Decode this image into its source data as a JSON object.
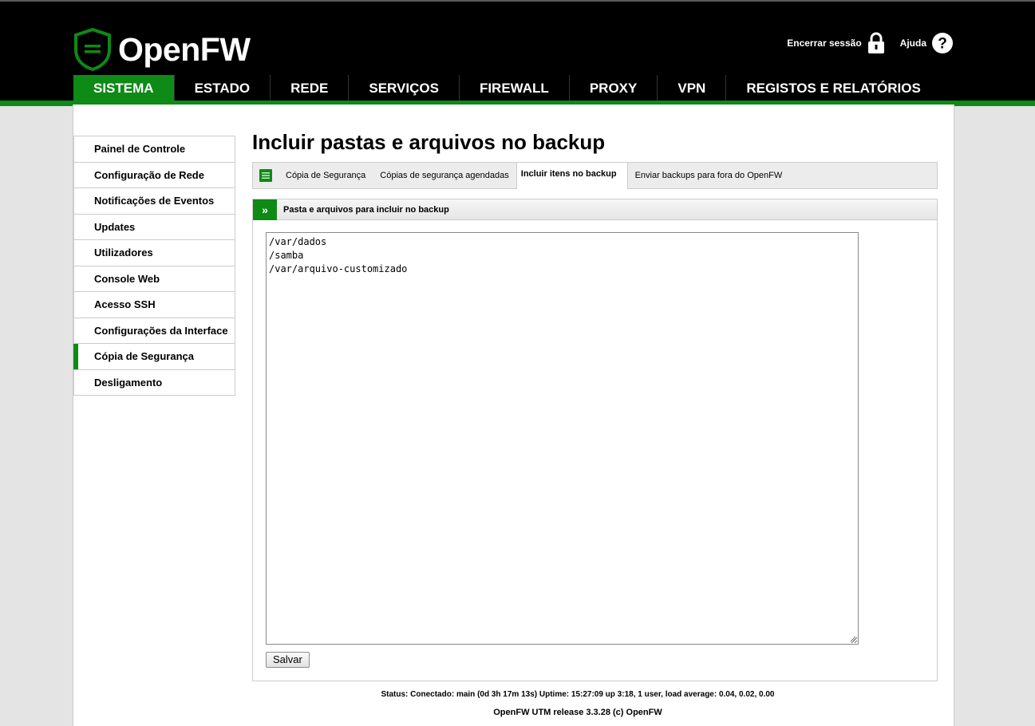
{
  "brand": {
    "name": "OpenFW",
    "accent_color": "#0e8a16"
  },
  "top_links": {
    "logout_label": "Encerrar sessão",
    "help_label": "Ajuda"
  },
  "nav": {
    "items": [
      {
        "label": "SISTEMA",
        "active": true
      },
      {
        "label": "ESTADO"
      },
      {
        "label": "REDE"
      },
      {
        "label": "SERVIÇOS"
      },
      {
        "label": "FIREWALL"
      },
      {
        "label": "PROXY"
      },
      {
        "label": "VPN"
      },
      {
        "label": "REGISTOS E RELATÓRIOS"
      }
    ]
  },
  "sidebar": {
    "items": [
      {
        "label": "Painel de Controle"
      },
      {
        "label": "Configuração de Rede"
      },
      {
        "label": "Notificações de Eventos"
      },
      {
        "label": "Updates"
      },
      {
        "label": "Utilizadores"
      },
      {
        "label": "Console Web"
      },
      {
        "label": "Acesso SSH"
      },
      {
        "label": "Configurações da Interface"
      },
      {
        "label": "Cópia de Segurança",
        "active": true
      },
      {
        "label": "Desligamento"
      }
    ]
  },
  "page": {
    "title": "Incluir pastas e arquivos no backup"
  },
  "tabs": {
    "items": [
      {
        "label": "Cópia de Segurança"
      },
      {
        "label": "Cópias de segurança agendadas"
      },
      {
        "label": "Incluir itens no backup",
        "active": true
      },
      {
        "label": "Enviar backups para fora do OpenFW"
      }
    ]
  },
  "section": {
    "title": "Pasta e arquivos para incluir no backup",
    "lines": [
      "/var/dados",
      "/samba",
      "/var/arquivo-customizado"
    ],
    "save_label": "Salvar"
  },
  "footer": {
    "status": "Status: Conectado: main (0d 3h 17m 13s) Uptime: 15:27:09 up 3:18, 1 user, load average: 0.04, 0.02, 0.00",
    "release": "OpenFW UTM release 3.3.28 (c) OpenFW"
  }
}
